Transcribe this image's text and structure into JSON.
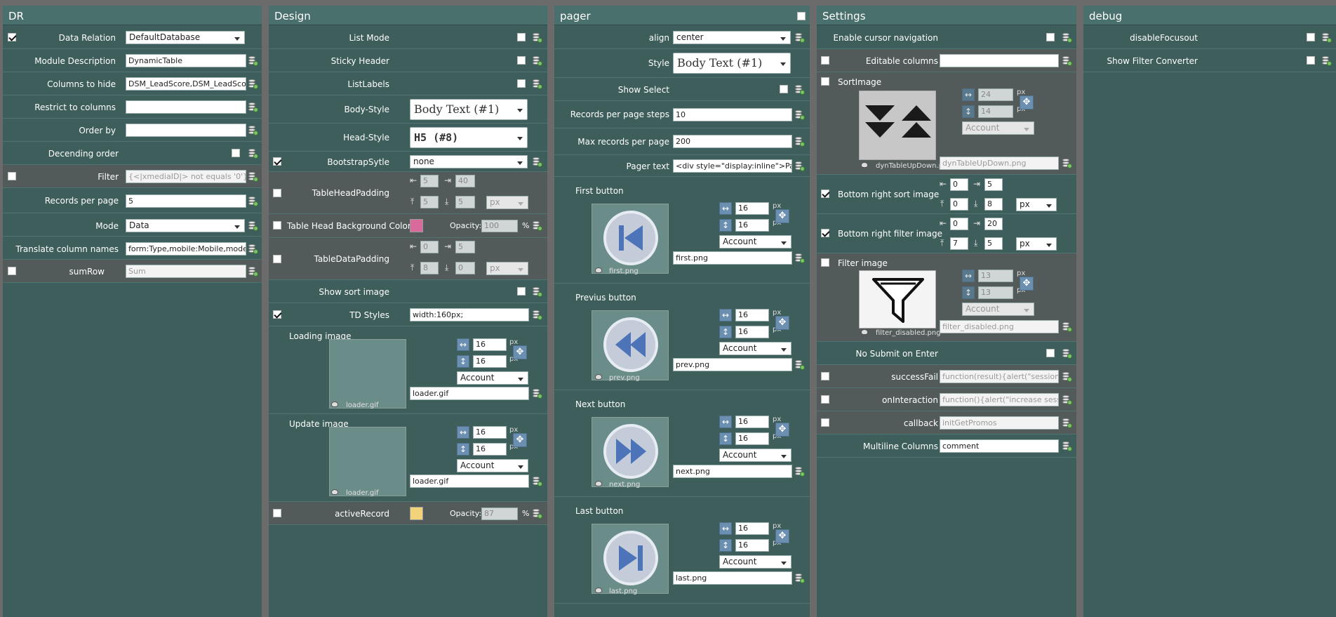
{
  "panels": {
    "dr": "DR",
    "design": "Design",
    "pager": "pager",
    "settings": "Settings",
    "debug": "debug"
  },
  "dr": {
    "data_relation": {
      "label": "Data Relation",
      "value": "DefaultDatabase"
    },
    "module_description": {
      "label": "Module Description",
      "value": "DynamicTable"
    },
    "columns_to_hide": {
      "label": "Columns to hide",
      "value": "DSM_LeadScore,DSM_LeadScoreS"
    },
    "restrict_to_columns": {
      "label": "Restrict to columns",
      "value": ""
    },
    "order_by": {
      "label": "Order by",
      "value": ""
    },
    "descending_order": {
      "label": "Decending order"
    },
    "filter": {
      "label": "Filter",
      "placeholder": "{<|xmediaID|> not equals '0'}"
    },
    "records_per_page": {
      "label": "Records per page",
      "value": "5"
    },
    "mode": {
      "label": "Mode",
      "value": "Data"
    },
    "translate_column_names": {
      "label": "Translate column names",
      "value": "form:Type,mobile:Mobile,model:M"
    },
    "sum_row": {
      "label": "sumRow",
      "placeholder": "Sum"
    }
  },
  "design": {
    "list_mode": "List Mode",
    "sticky_header": "Sticky Header",
    "list_labels": "ListLabels",
    "body_style": {
      "label": "Body-Style",
      "value": "Body Text (#1)"
    },
    "head_style": {
      "label": "Head-Style",
      "value": "H5 (#8)"
    },
    "bootstrap_style": {
      "label": "BootstrapSytle",
      "value": "none"
    },
    "table_head_padding": {
      "label": "TableHeadPadding",
      "v1": "5",
      "v2": "40",
      "v3": "5",
      "v4": "5",
      "unit": "px"
    },
    "table_head_bg": {
      "label": "Table Head Background Color",
      "opacity_label": "Opacity:",
      "opacity": "100",
      "pct": "%",
      "color": "#d86a9c"
    },
    "table_data_padding": {
      "label": "TableDataPadding",
      "v1": "0",
      "v2": "5",
      "v3": "8",
      "v4": "0",
      "unit": "px"
    },
    "show_sort_image": "Show sort image",
    "td_styles": {
      "label": "TD Styles",
      "value": "width:160px;"
    },
    "loading_image": {
      "label": "Loading image",
      "w": "16",
      "h": "16",
      "unit": "px",
      "scope": "Account",
      "file": "loader.gif",
      "caption": "loader.gif"
    },
    "update_image": {
      "label": "Update image",
      "w": "16",
      "h": "16",
      "unit": "px",
      "scope": "Account",
      "file": "loader.gif",
      "caption": "loader.gif"
    },
    "active_record": {
      "label": "activeRecord",
      "opacity_label": "Opacity:",
      "opacity": "87",
      "pct": "%",
      "color": "#f2d37a"
    }
  },
  "pager": {
    "align": {
      "label": "align",
      "value": "center"
    },
    "style": {
      "label": "Style",
      "value": "Body Text (#1)"
    },
    "show_select": "Show Select",
    "records_per_page_steps": {
      "label": "Records per page steps",
      "value": "10"
    },
    "max_records_per_page": {
      "label": "Max records per page",
      "value": "200"
    },
    "pager_text": {
      "label": "Pager text",
      "value": "<div style=\"display:inline\">Page {"
    },
    "first": {
      "label": "First button",
      "w": "16",
      "h": "16",
      "unit": "px",
      "scope": "Account",
      "file": "first.png",
      "caption": "first.png"
    },
    "prev": {
      "label": "Previus button",
      "w": "16",
      "h": "16",
      "unit": "px",
      "scope": "Account",
      "file": "prev.png",
      "caption": "prev.png"
    },
    "next": {
      "label": "Next button",
      "w": "16",
      "h": "16",
      "unit": "px",
      "scope": "Account",
      "file": "next.png",
      "caption": "next.png"
    },
    "last": {
      "label": "Last button",
      "w": "16",
      "h": "16",
      "unit": "px",
      "scope": "Account",
      "file": "last.png",
      "caption": "last.png"
    }
  },
  "settings": {
    "enable_cursor_navigation": "Enable cursor navigation",
    "editable_columns": {
      "label": "Editable columns",
      "value": ""
    },
    "sort_image": {
      "label": "SortImage",
      "w": "24",
      "h": "14",
      "unit": "px",
      "scope": "Account",
      "file": "dynTableUpDown.png",
      "caption": "dynTableUpDown.p"
    },
    "bottom_right_sort": {
      "label": "Bottom right sort image",
      "v1": "0",
      "v2": "5",
      "v3": "0",
      "v4": "8",
      "unit": "px"
    },
    "bottom_right_filter": {
      "label": "Bottom right filter image",
      "v1": "0",
      "v2": "20",
      "v3": "7",
      "v4": "5",
      "unit": "px"
    },
    "filter_image": {
      "label": "Filter image",
      "w": "13",
      "h": "13",
      "unit": "px",
      "scope": "Account",
      "file": "filter_disabled.png",
      "caption": "filter_disabled.png"
    },
    "no_submit_on_enter": "No Submit on Enter",
    "success_fail": {
      "label": "successFail",
      "placeholder": "function(result){alert(\"session exp"
    },
    "on_interaction": {
      "label": "onInteraction",
      "placeholder": "function(){alert(\"increase session"
    },
    "callback": {
      "label": "callback",
      "placeholder": "initGetPromos"
    },
    "multiline_columns": {
      "label": "Multiline Columns",
      "value": "comment"
    }
  },
  "debug": {
    "disable_focusout": "disableFocusout",
    "show_filter_converter": "Show Filter Converter"
  }
}
